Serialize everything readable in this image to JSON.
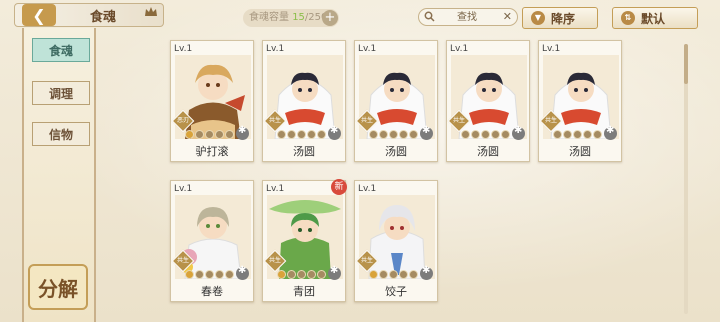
{
  "header": {
    "title": "食魂",
    "capacity_label": "食魂容量",
    "capacity_current": "15",
    "capacity_total": "/250",
    "search_text": "查找",
    "sort_desc": "降序",
    "sort_default": "默认"
  },
  "sidebar": {
    "tabs": [
      "食魂",
      "调理",
      "信物"
    ],
    "decompose": "分解"
  },
  "cards": [
    {
      "lv": "Lv.1",
      "name": "驴打滚",
      "badge": "恶刃",
      "stars": 1
    },
    {
      "lv": "Lv.1",
      "name": "汤圆",
      "badge": "共生",
      "stars": 0
    },
    {
      "lv": "Lv.1",
      "name": "汤圆",
      "badge": "共生",
      "stars": 0
    },
    {
      "lv": "Lv.1",
      "name": "汤圆",
      "badge": "共生",
      "stars": 0
    },
    {
      "lv": "Lv.1",
      "name": "汤圆",
      "badge": "共生",
      "stars": 0
    },
    {
      "lv": "Lv.1",
      "name": "春卷",
      "badge": "共生",
      "stars": 1
    },
    {
      "lv": "Lv.1",
      "name": "青团",
      "badge": "共生",
      "stars": 1,
      "new": "新"
    },
    {
      "lv": "Lv.1",
      "name": "饺子",
      "badge": "共生",
      "stars": 1
    }
  ],
  "colors": {
    "accent": "#c49e57",
    "active_tab": "#bfe3d8"
  }
}
